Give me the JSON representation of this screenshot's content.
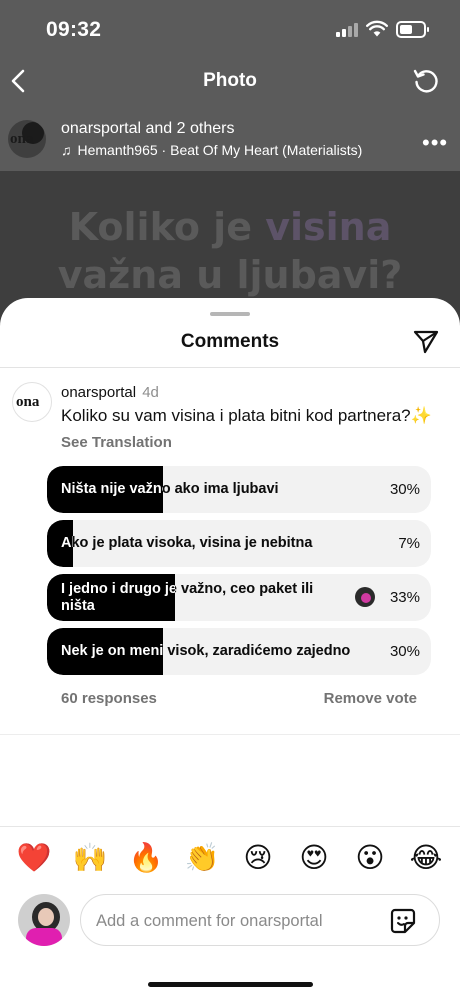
{
  "status_bar": {
    "time": "09:32"
  },
  "nav": {
    "title": "Photo"
  },
  "post": {
    "user_line": "onarsportal and 2 others",
    "music": "Hemanth965 · Beat Of My Heart (Materialists)",
    "avatar_logo": "ona",
    "photo_line1_a": "Koliko je ",
    "photo_line1_b": "visina",
    "photo_line2": "važna u ljubavi?"
  },
  "sheet": {
    "title": "Comments"
  },
  "comment": {
    "avatar_logo": "ona",
    "username": "onarsportal",
    "time": "4d",
    "text": "Koliko su vam visina i plata bitni kod partnera?✨",
    "translate": "See Translation"
  },
  "poll": {
    "options": [
      {
        "label": "Ništa nije važno ako ima ljubavi",
        "percent": 30,
        "percent_label": "30%"
      },
      {
        "label": "Ako je plata visoka, visina je nebitna",
        "percent": 7,
        "percent_label": "7%"
      },
      {
        "label": "I jedno i drugo je važno, ceo paket ili ništa",
        "percent": 33,
        "percent_label": "33%",
        "my_vote": true
      },
      {
        "label": "Nek je on meni visok, zaradićemo zajedno",
        "percent": 30,
        "percent_label": "30%"
      }
    ],
    "responses": "60 responses",
    "remove_vote": "Remove vote"
  },
  "emoji_bar": [
    "❤️",
    "🙌",
    "🔥",
    "👏",
    "😢",
    "😍",
    "😮",
    "😂"
  ],
  "input": {
    "placeholder": "Add a comment for onarsportal"
  }
}
